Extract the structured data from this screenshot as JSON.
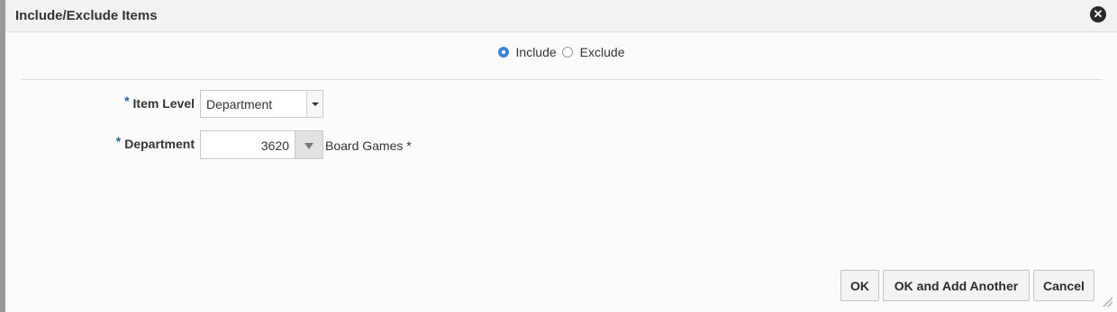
{
  "dialog": {
    "title": "Include/Exclude Items",
    "close_icon": "close-icon"
  },
  "mode": {
    "options": [
      {
        "label": "Include",
        "selected": true
      },
      {
        "label": "Exclude",
        "selected": false
      }
    ]
  },
  "form": {
    "item_level": {
      "required_marker": "*",
      "label": "Item Level",
      "value": "Department"
    },
    "department": {
      "required_marker": "*",
      "label": "Department",
      "value": "3620",
      "description": "Board Games *"
    }
  },
  "buttons": {
    "ok": "OK",
    "ok_add_another": "OK and Add Another",
    "cancel": "Cancel"
  },
  "colors": {
    "accent": "#3b84d8",
    "required": "#1f5da8"
  }
}
